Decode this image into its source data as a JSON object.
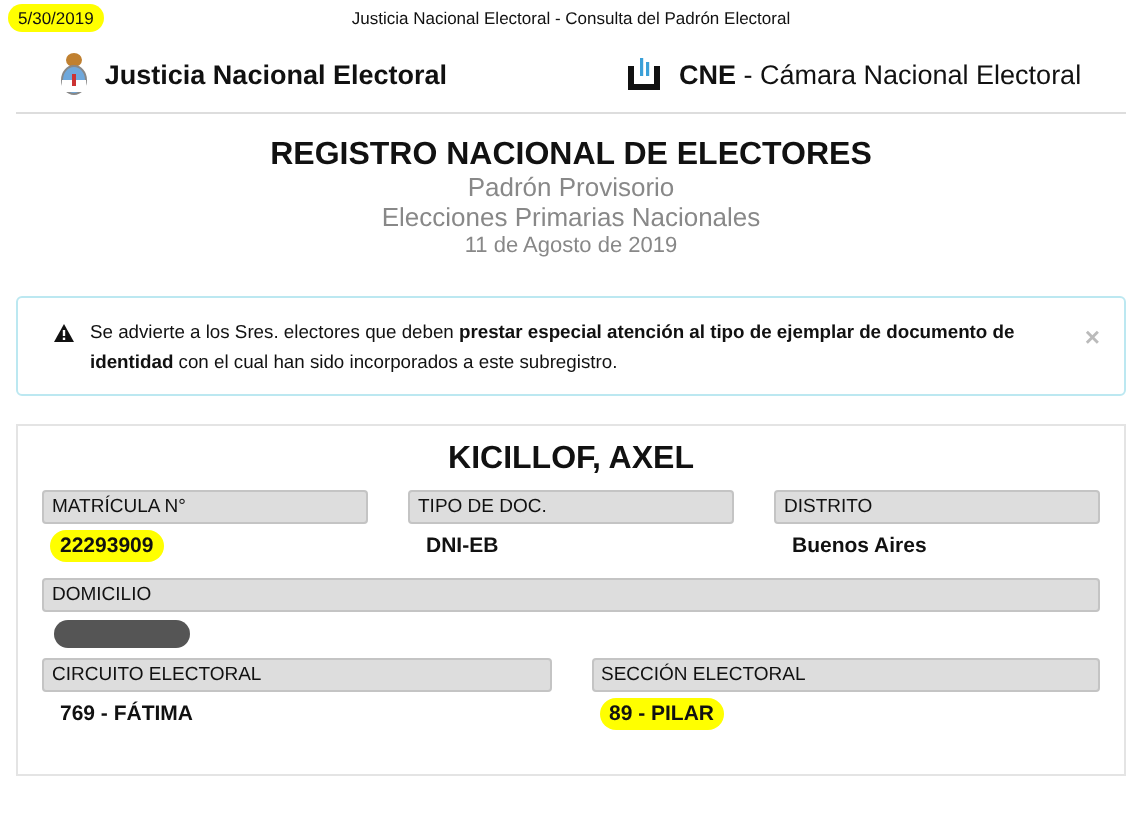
{
  "print_header": {
    "date": "5/30/2019",
    "date_highlighted": true,
    "title": "Justicia Nacional Electoral - Consulta del Padrón Electoral"
  },
  "brands": [
    {
      "kind": "shield",
      "name": "Justicia Nacional Electoral"
    },
    {
      "kind": "cne",
      "name": "**CNE** - Cámara Nacional Electoral"
    }
  ],
  "heading": {
    "title": "REGISTRO NACIONAL DE ELECTORES",
    "subtitles": [
      "Padrón Provisorio",
      "Elecciones Primarias Nacionales"
    ],
    "date": "11 de Agosto de 2019"
  },
  "alert": {
    "text": "Se advierte a los Sres. electores que deben **prestar especial atención al tipo de ejemplar de documento de identidad** con el cual han sido incorporados a este subregistro.",
    "close": "×"
  },
  "record": {
    "name": "KICILLOF, AXEL",
    "rows": [
      {
        "fields": [
          {
            "label": "MATRÍCULA N°",
            "value": "22293909",
            "highlighted": true
          },
          {
            "label": "TIPO DE DOC.",
            "value": "DNI-EB",
            "highlighted": false
          },
          {
            "label": "DISTRITO",
            "value": "Buenos Aires",
            "highlighted": false
          }
        ]
      },
      {
        "fields": [
          {
            "label": "DOMICILIO",
            "redacted": true
          }
        ]
      },
      {
        "fields": [
          {
            "label": "CIRCUITO ELECTORAL",
            "value": "769 - FÁTIMA",
            "highlighted": false
          },
          {
            "label": "SECCIÓN ELECTORAL",
            "value": "89 - PILAR",
            "highlighted": true
          }
        ]
      }
    ]
  }
}
